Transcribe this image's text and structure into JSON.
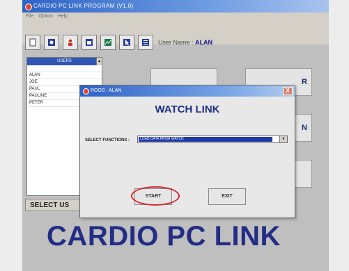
{
  "window": {
    "title": "CARDIO PC LINK PROGRAM (V1.0)"
  },
  "menu": [
    "File",
    "Option",
    "Help"
  ],
  "toolbar": {
    "buttons": [
      {
        "name": "new-document-icon",
        "color": "#ffffff"
      },
      {
        "name": "camera-icon",
        "color": "#2a3f9a"
      },
      {
        "name": "doctor-icon",
        "color": "#c23a2a"
      },
      {
        "name": "window-icon",
        "color": "#2a3f9a"
      },
      {
        "name": "chart-icon",
        "color": "#1f7a4a"
      },
      {
        "name": "cursor-icon",
        "color": "#2a3f9a"
      },
      {
        "name": "list-icon",
        "color": "#2a3f9a"
      }
    ],
    "user_label": "User Name :",
    "user_value": "ALAN"
  },
  "users": {
    "header": "USERS",
    "items": [
      "ALAN",
      "JOE",
      "PAUL",
      "PAULINE",
      "PETER"
    ]
  },
  "background_buttons": {
    "right_top_label": "R",
    "right_middle_label": "N"
  },
  "select_users_label": "SELECT US",
  "brand": "CARDIO PC LINK",
  "dialog": {
    "title": "ROOS : ALAN",
    "heading": "WATCH LINK",
    "select_label": "SELECT FUNCTIONS :",
    "select_value": "LOAD DATA FROM WATCH",
    "start_label": "START",
    "exit_label": "EXIT",
    "close_glyph": "X"
  },
  "colors": {
    "accent": "#2e63c7",
    "brand": "#232d86",
    "highlight": "#d62a2a"
  }
}
